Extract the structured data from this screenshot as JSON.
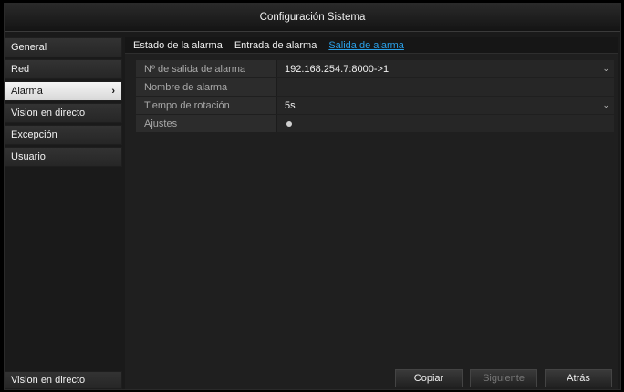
{
  "window": {
    "title": "Configuración Sistema"
  },
  "sidebar": {
    "items": [
      {
        "label": "General"
      },
      {
        "label": "Red"
      },
      {
        "label": "Alarma",
        "active": true
      },
      {
        "label": "Vision en directo"
      },
      {
        "label": "Excepción"
      },
      {
        "label": "Usuario"
      }
    ],
    "bottom_label": "Vision en directo"
  },
  "tabs": [
    {
      "label": "Estado de la alarma"
    },
    {
      "label": "Entrada de alarma"
    },
    {
      "label": "Salida de alarma",
      "active": true
    }
  ],
  "form": {
    "rows": [
      {
        "label": "Nº de salida de alarma",
        "value": "192.168.254.7:8000->1"
      },
      {
        "label": "Nombre de alarma",
        "value": ""
      },
      {
        "label": "Tiempo de rotación",
        "value": "5s"
      },
      {
        "label": "Ajustes"
      }
    ]
  },
  "buttons": {
    "copy": "Copiar",
    "next": "Siguiente",
    "back": "Atrás"
  },
  "colors": {
    "accent": "#2aa0e8",
    "active_item_bg": "#e8e8e8",
    "background": "#1a1a1a"
  }
}
